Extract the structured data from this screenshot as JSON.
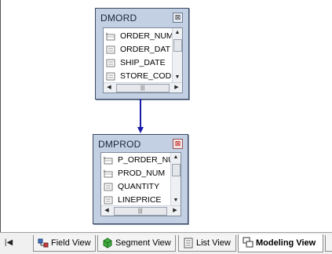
{
  "canvas": {
    "tables": [
      {
        "title": "DMORD",
        "columns": [
          {
            "name": "ORDER_NUM",
            "key": true
          },
          {
            "name": "ORDER_DAT",
            "key": false
          },
          {
            "name": "SHIP_DATE",
            "key": false
          },
          {
            "name": "STORE_COD",
            "key": false
          }
        ]
      },
      {
        "title": "DMPROD",
        "columns": [
          {
            "name": "P_ORDER_NU",
            "key": true
          },
          {
            "name": "PROD_NUM",
            "key": true
          },
          {
            "name": "QUANTITY",
            "key": false
          },
          {
            "name": "LINEPRICE",
            "key": false
          }
        ]
      }
    ],
    "relationship_color": "#1a1aa8"
  },
  "tabs": {
    "items": [
      {
        "label": "Field View",
        "icon": "field-view-icon"
      },
      {
        "label": "Segment View",
        "icon": "segment-view-icon"
      },
      {
        "label": "List View",
        "icon": "list-view-icon"
      },
      {
        "label": "Modeling View",
        "icon": "modeling-view-icon"
      }
    ],
    "active": "Modeling View"
  }
}
